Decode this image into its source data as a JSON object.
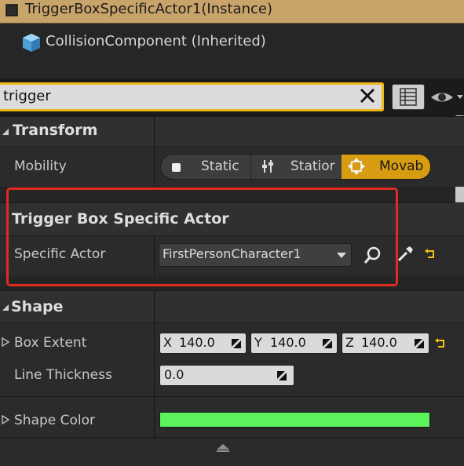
{
  "header": {
    "title": "TriggerBoxSpecificActor1(Instance)",
    "accent_color": "#c9a46a"
  },
  "tree": {
    "item_label": "CollisionComponent (Inherited)"
  },
  "search": {
    "value": "trigger",
    "border_color": "#f1b81c"
  },
  "sections": {
    "transform": {
      "title": "Transform",
      "mobility_label": "Mobility",
      "mobility_options": [
        "Static",
        "Statior",
        "Movab"
      ],
      "selected_option": "Movab",
      "selected_color": "#d89c12"
    },
    "trigger": {
      "title": "Trigger Box Specific Actor",
      "specific_actor_label": "Specific Actor",
      "specific_actor_value": "FirstPersonCharacter1",
      "highlight_color": "#e12b21"
    },
    "shape": {
      "title": "Shape",
      "box_extent_label": "Box Extent",
      "box_extent": [
        {
          "axis": "X",
          "value": "140.0"
        },
        {
          "axis": "Y",
          "value": "140.0"
        },
        {
          "axis": "Z",
          "value": "140.0"
        }
      ],
      "line_thickness_label": "Line Thickness",
      "line_thickness_value": "0.0",
      "shape_color_label": "Shape Color",
      "shape_color": "#5df35d"
    }
  },
  "icons": {
    "header_icon": "actor-icon",
    "tree_icon": "cube-icon",
    "clear": "close-icon",
    "view": "grid-view-icon",
    "visibility": "eye-icon",
    "browse": "search-icon",
    "pick": "eyedropper-icon",
    "reset": "reset-arrow-icon",
    "expand": "advanced-expand-icon"
  }
}
